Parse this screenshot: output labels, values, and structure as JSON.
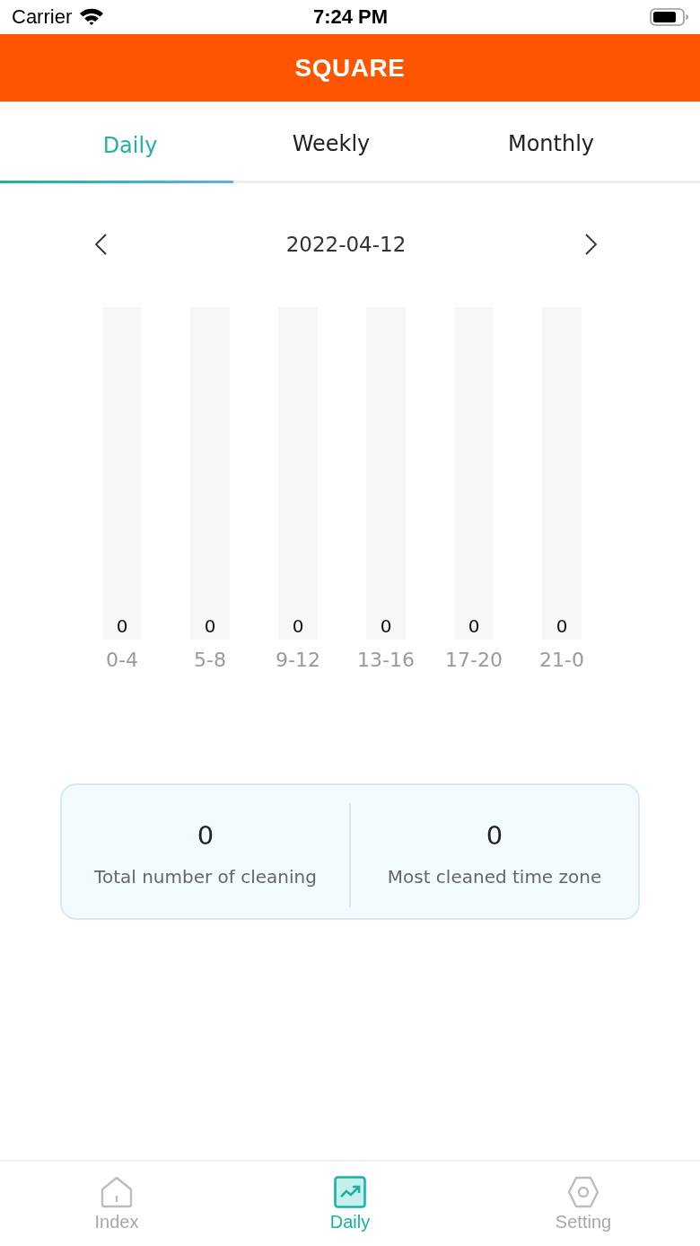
{
  "status_bar": {
    "carrier": "Carrier",
    "time": "7:24 PM"
  },
  "header": {
    "title": "SQUARE"
  },
  "tabs": [
    {
      "label": "Daily",
      "selected": true
    },
    {
      "label": "Weekly",
      "selected": false
    },
    {
      "label": "Monthly",
      "selected": false
    }
  ],
  "date_nav": {
    "date": "2022-04-12"
  },
  "columns": [
    {
      "value": "0",
      "label": "0-4"
    },
    {
      "value": "0",
      "label": "5-8"
    },
    {
      "value": "0",
      "label": "9-12"
    },
    {
      "value": "0",
      "label": "13-16"
    },
    {
      "value": "0",
      "label": "17-20"
    },
    {
      "value": "0",
      "label": "21-0"
    }
  ],
  "stats": [
    {
      "value": "0",
      "label": "Total number of cleaning"
    },
    {
      "value": "0",
      "label": "Most cleaned time zone"
    }
  ],
  "bottom_nav": [
    {
      "label": "Index",
      "selected": false
    },
    {
      "label": "Daily",
      "selected": true
    },
    {
      "label": "Setting",
      "selected": false
    }
  ]
}
